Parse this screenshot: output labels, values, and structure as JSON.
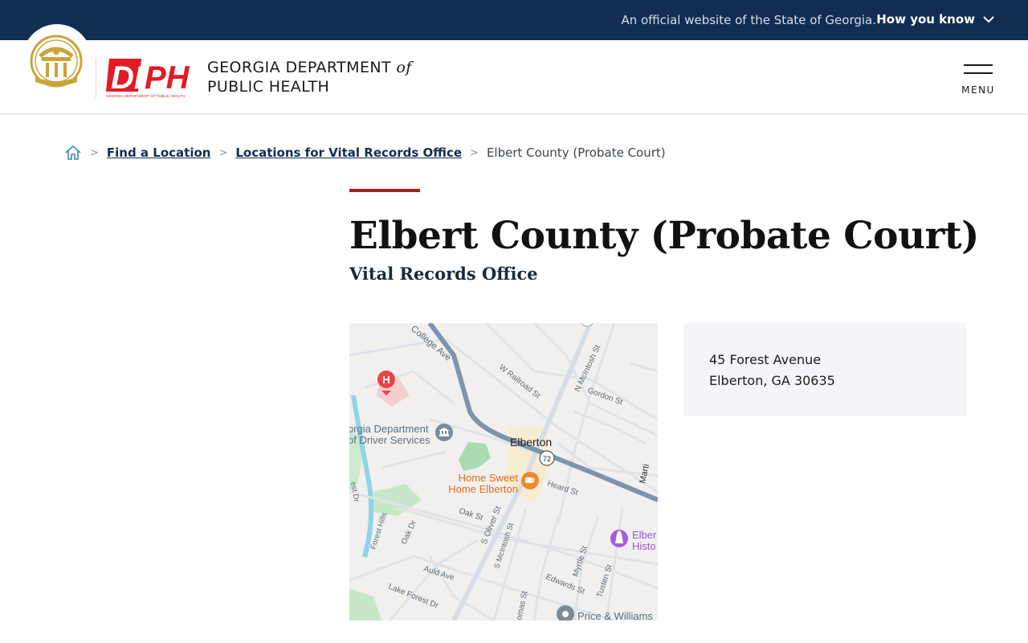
{
  "banner": {
    "official_text": "An official website of the State of Georgia.",
    "how_you_know": "How you know",
    "background_color": "#112e51"
  },
  "header": {
    "agency_line1": "GEORGIA DEPARTMENT",
    "agency_of": "of",
    "agency_line2": "PUBLIC HEALTH",
    "logo_letters": "DPH",
    "logo_caption": "GEORGIA DEPARTMENT OF PUBLIC HEALTH",
    "menu_label": "MENU",
    "brand_red": "#e21b25",
    "seal_gold": "#c9a43a"
  },
  "breadcrumb": {
    "home_icon": "home-icon",
    "items": [
      {
        "label": "Find a Location",
        "link": true
      },
      {
        "label": "Locations for Vital Records Office",
        "link": true
      },
      {
        "label": "Elbert County (Probate Court)",
        "link": false
      }
    ]
  },
  "page": {
    "title": "Elbert County (Probate Court)",
    "subtitle": "Vital Records Office",
    "accent_color": "#a51e22"
  },
  "map": {
    "labels": {
      "city": "Elberton",
      "college_ave": "College Ave",
      "w_railroad": "W Railroad St",
      "n_mcintosh": "N McIntosh St",
      "gordon": "Gordon St",
      "dds_line1": "orgia Department",
      "dds_line2": "of Driver Services",
      "home_sweet_1": "Home Sweet",
      "home_sweet_2": "Home Elberton",
      "heard": "Heard St",
      "oak": "Oak St",
      "oak_dr": "Oak Dr",
      "s_oliver": "S Oliver St",
      "s_mcintosh": "S McIntosh St",
      "forest_hills": "Forest Hills",
      "est_dr": "est Dr",
      "auld": "Auld Ave",
      "lake_forest": "Lake Forest Dr",
      "myrtle": "Myrtle St",
      "tusten": "Tusten St",
      "edwards": "Edwards St",
      "thomas": "omas St",
      "price_williams": "Price & Williams",
      "elbert_hist_1": "Elber",
      "elbert_hist_2": "Histo",
      "martin": "Marti",
      "route": "72"
    },
    "icons": [
      "hospital-icon",
      "government-building-icon",
      "cafe-icon",
      "museum-icon",
      "place-pin-icon"
    ]
  },
  "address": {
    "line1": "45 Forest Avenue",
    "line2": "Elberton, GA 30635"
  }
}
